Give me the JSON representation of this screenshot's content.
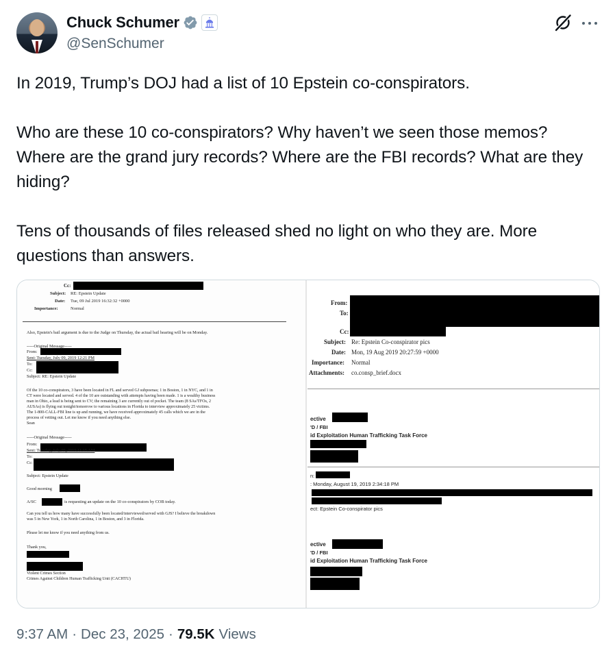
{
  "author": {
    "display_name": "Chuck Schumer",
    "handle": "@SenSchumer",
    "verified_color": "#829aab"
  },
  "tweet": {
    "paragraph1": "In 2019, Trump’s DOJ had a list of 10 Epstein co-conspirators.",
    "paragraph2": "Who are these 10 co-conspirators? Why haven’t we seen those memos? Where are the grand jury records? Where are the FBI records? What are they hiding?",
    "paragraph3": "Tens of thousands of files released shed no light on who they are. More questions than answers."
  },
  "left_doc": {
    "cc_label": "Cc:",
    "subject_label": "Subject:",
    "subject_value": "RE: Epstein Update",
    "date_label": "Date:",
    "date_value": "Tue, 09 Jul 2019 16:32:32 +0000",
    "importance_label": "Importance:",
    "importance_value": "Normal",
    "para1": "Also, Epstein's bail argument is due to the Judge on Thursday, the actual bail hearing will be on Monday.",
    "orig1_header": "-----Original Message-----",
    "orig1_from": "From:",
    "orig1_sent": "Sent: Tuesday, July 09, 2019 12:21 PM",
    "orig1_to": "To:",
    "orig1_cc": "Cc:",
    "orig1_subject": "Subject: RE: Epstein Update",
    "body_lines": [
      "Of the 10 co-conspirators, 3 have been located in FL and served GJ subpoenas; 1 in Boston, 1 in NYC, and 1 in",
      "CT were located and served. 4 of the 10 are outstanding with attempts having been made. 1 is a wealthy business",
      "man in Ohio, a lead is being sent to CV; the remaining 3 are currently out of pocket. The team (8 SAs/TFOs, 2",
      "AUSAs) is flying out tonight/tomorrow to various locations in Florida to interview approximately 25 victims.",
      "The 1-800-CALL-FBI line is up and running, we have received approximately 45 calls which we are in the",
      "process of vetting out. Let me know if you need anything else.",
      "Sean"
    ],
    "orig2_header": "-----Original Message-----",
    "orig2_from": "From:",
    "orig2_sent": "Sent: Tuesday, July 09, 2019 11:15 AM",
    "orig2_to": "To:",
    "orig2_cc": "Cc:",
    "orig2_subject": "Subject: Epstein Update",
    "good_morning": "Good morning",
    "asac_line_a": "A/SC",
    "asac_line_b": "is requesting an update on the 10 co-conspirators by COB today.",
    "question_line1": "Can you tell us how many have successfully been located/interviewed/served with GJS? I believe the breakdown",
    "question_line2": "was 5 in New York, 1 in North Carolina, 1 in Boston, and 3 in Florida.",
    "please_line": "Please let me know if you need anything from us.",
    "thank_you": "Thank you,",
    "sig_unit1": "Violent Crimes Section",
    "sig_unit2": "Crimes Against Children Human Trafficking Unit (CACHTU)"
  },
  "right_doc": {
    "from_label": "From:",
    "to_label": "To:",
    "cc_label": "Cc:",
    "subject_label": "Subject:",
    "subject_value": "Re: Epstein Co-conspirator pics",
    "date_label": "Date:",
    "date_value": "Mon, 19 Aug 2019 20:27:59 +0000",
    "importance_label": "Importance:",
    "importance_value": "Normal",
    "attachments_label": "Attachments:",
    "attachments_value": "co.consp_brief.docx",
    "sig1_line1": "ective",
    "sig1_line2": "'D / FBI",
    "sig1_line3": "id Exploitation Human Trafficking Task Force",
    "msg_from": "n:",
    "msg_sent": ": Monday, August 19, 2019 2:34:18 PM",
    "msg_subject": "ect: Epstein Co-conspirator pics",
    "sig2_line1": "ective",
    "sig2_line2": "'D / FBI",
    "sig2_line3": "id Exploitation Human Trafficking Task Force"
  },
  "footer": {
    "time": "9:37 AM",
    "sep1": "·",
    "date": "Dec 23, 2025",
    "sep2": "·",
    "views_count": "79.5K",
    "views_label": "Views"
  }
}
